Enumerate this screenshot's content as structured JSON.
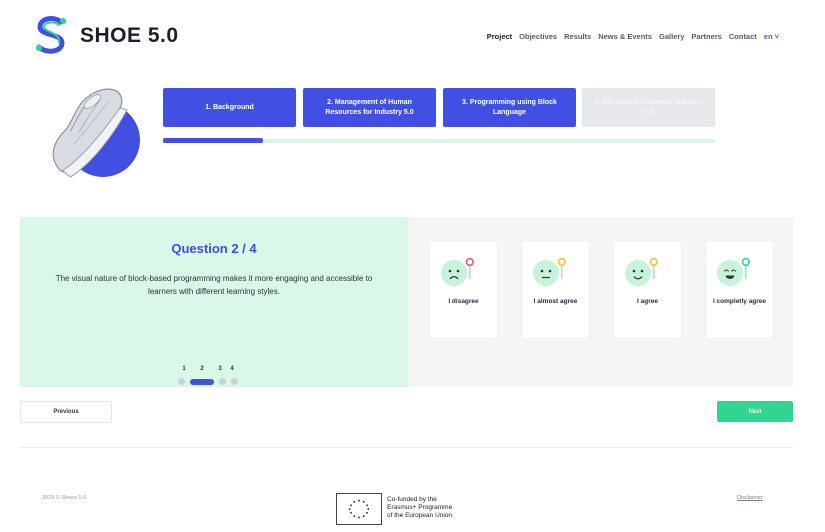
{
  "brand": {
    "name": "SHOE 5.0",
    "logo_icon": "shoe-s-logo-icon"
  },
  "nav": {
    "items": [
      "Project",
      "Objectives",
      "Results",
      "News & Events",
      "Gallery",
      "Partners",
      "Contact"
    ],
    "language": "en ˅"
  },
  "steps": [
    {
      "label": "1. Background",
      "state": "active"
    },
    {
      "label": "2. Management of Human Resources for Industry 5.0",
      "state": "active"
    },
    {
      "label": "3. Programming using Block Language",
      "state": "active"
    },
    {
      "label": "4. Big Data in Footwear Industry 5.0",
      "state": "disabled"
    }
  ],
  "progress": {
    "percent": 18
  },
  "question": {
    "title": "Question 2 / 4",
    "text": "The visual nature of block-based programming makes it more engaging and accessible to learners with different learning styles.",
    "pages": [
      "1",
      "2",
      "3",
      "4"
    ],
    "current_page": 2
  },
  "answers": [
    {
      "label": "I disagree",
      "icon": "sad-face-icon"
    },
    {
      "label": "I almost agree",
      "icon": "neutral-face-icon"
    },
    {
      "label": "I agree",
      "icon": "smile-face-icon"
    },
    {
      "label": "I completly agree",
      "icon": "happy-face-icon"
    }
  ],
  "buttons": {
    "previous": "Previous",
    "next": "Next"
  },
  "footer": {
    "copyright": "2023 © Shoes 5.0",
    "eu_text": [
      "Co-funded by the",
      "Erasmus+ Programme",
      "of the European Union"
    ],
    "disclaimer": "Disclaimer"
  },
  "colors": {
    "primary": "#4150e3",
    "accent": "#2fd68f",
    "panel": "#d9f8e8",
    "face_bg": "#c6f3da"
  }
}
